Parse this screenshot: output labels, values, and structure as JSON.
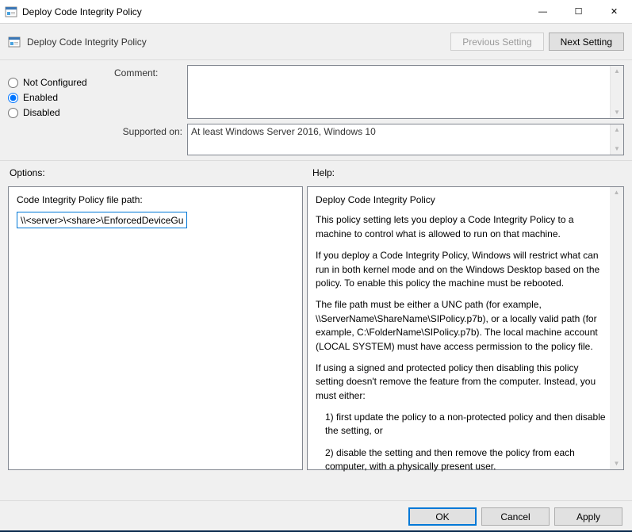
{
  "window": {
    "title": "Deploy Code Integrity Policy",
    "minimize": "—",
    "maximize": "☐",
    "close": "✕"
  },
  "header": {
    "title": "Deploy Code Integrity Policy",
    "prev": "Previous Setting",
    "next": "Next Setting"
  },
  "state": {
    "radios": {
      "not_configured": "Not Configured",
      "enabled": "Enabled",
      "disabled": "Disabled"
    },
    "selected": "Enabled"
  },
  "info": {
    "comment_label": "Comment:",
    "comment_value": "",
    "supported_label": "Supported on:",
    "supported_value": "At least Windows Server 2016, Windows 10"
  },
  "labels": {
    "options": "Options:",
    "help": "Help:"
  },
  "options": {
    "path_label": "Code Integrity Policy file path:",
    "path_value": "\\\\<server>\\<share>\\EnforcedDeviceGua"
  },
  "help": {
    "title": "Deploy Code Integrity Policy",
    "p1": "This policy setting lets you deploy a Code Integrity Policy to a machine to control what is allowed to run on that machine.",
    "p2": "If you deploy a Code Integrity Policy, Windows will restrict what can run in both kernel mode and on the Windows Desktop based on the policy. To enable this policy the machine must be rebooted.",
    "p3": "The file path must be either a UNC path (for example, \\\\ServerName\\ShareName\\SIPolicy.p7b), or a locally valid path (for example, C:\\FolderName\\SIPolicy.p7b).  The local machine account (LOCAL SYSTEM) must have access permission to the policy file.",
    "p4": "If using a signed and protected policy then disabling this policy setting doesn't remove the feature from the computer. Instead, you must either:",
    "p5": "1) first update the policy to a non-protected policy and then disable the setting, or",
    "p6": "2) disable the setting and then remove the policy from each computer, with a physically present user."
  },
  "footer": {
    "ok": "OK",
    "cancel": "Cancel",
    "apply": "Apply"
  }
}
